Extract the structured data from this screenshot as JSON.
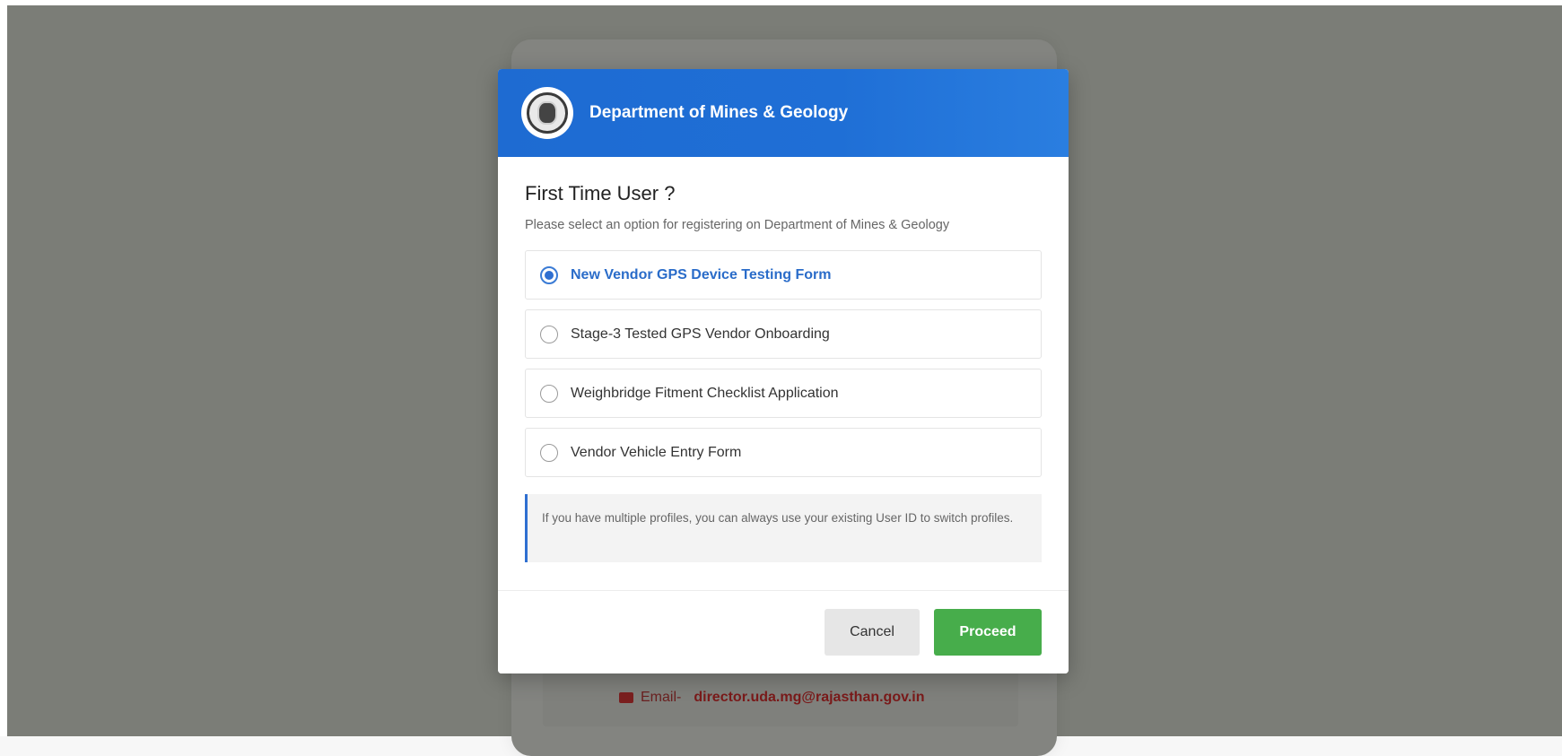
{
  "background": {
    "email_label": "Email-",
    "email_value": "director.uda.mg@rajasthan.gov.in"
  },
  "modal": {
    "header_title": "Department of Mines & Geology",
    "title": "First Time User ?",
    "subtitle": "Please select an option for registering on Department of Mines & Geology",
    "options": [
      {
        "label": "New Vendor GPS Device Testing Form",
        "selected": true
      },
      {
        "label": "Stage-3 Tested GPS Vendor Onboarding",
        "selected": false
      },
      {
        "label": "Weighbridge Fitment Checklist Application",
        "selected": false
      },
      {
        "label": "Vendor Vehicle Entry Form",
        "selected": false
      }
    ],
    "note": "If you have multiple profiles, you can always use your existing User ID to switch profiles.",
    "cancel_label": "Cancel",
    "proceed_label": "Proceed"
  },
  "colors": {
    "header_blue": "#1f6fd6",
    "selected_blue": "#2a6cc9",
    "proceed_green": "#47ad4b",
    "overlay_gray": "#7b7d77"
  },
  "icons": {
    "logo": "department-emblem-icon",
    "radio_checked": "radio-checked-icon",
    "radio_unchecked": "radio-unchecked-icon",
    "mail": "mail-icon"
  }
}
